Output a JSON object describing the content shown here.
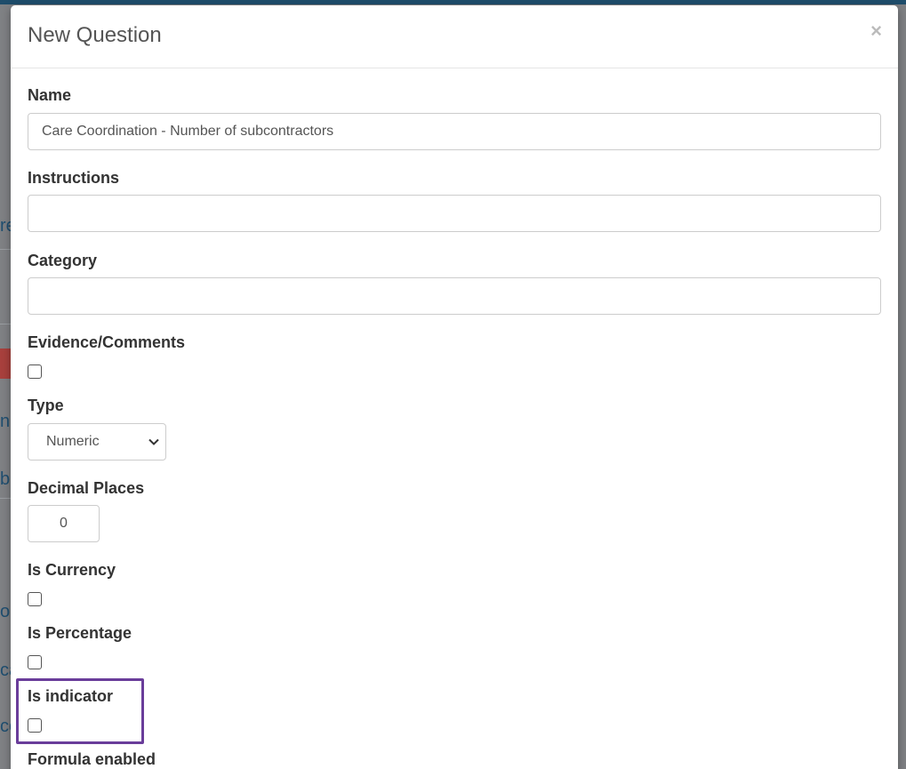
{
  "modal": {
    "title": "New Question",
    "close_symbol": "×"
  },
  "fields": {
    "name": {
      "label": "Name",
      "value": "Care Coordination - Number of subcontractors"
    },
    "instructions": {
      "label": "Instructions",
      "value": ""
    },
    "category": {
      "label": "Category",
      "value": ""
    },
    "evidence": {
      "label": "Evidence/Comments",
      "checked": false
    },
    "type": {
      "label": "Type",
      "value": "Numeric"
    },
    "decimal_places": {
      "label": "Decimal Places",
      "value": "0"
    },
    "is_currency": {
      "label": "Is Currency",
      "checked": false
    },
    "is_percentage": {
      "label": "Is Percentage",
      "checked": false
    },
    "is_indicator": {
      "label": "Is indicator",
      "checked": false
    },
    "formula_enabled": {
      "label": "Formula enabled"
    }
  },
  "background": {
    "fragments": [
      "re",
      "s",
      "np",
      "b",
      "or",
      "ca",
      "co"
    ]
  },
  "colors": {
    "highlight": "#6a3d9a",
    "topbar": "#1e4d6b"
  }
}
